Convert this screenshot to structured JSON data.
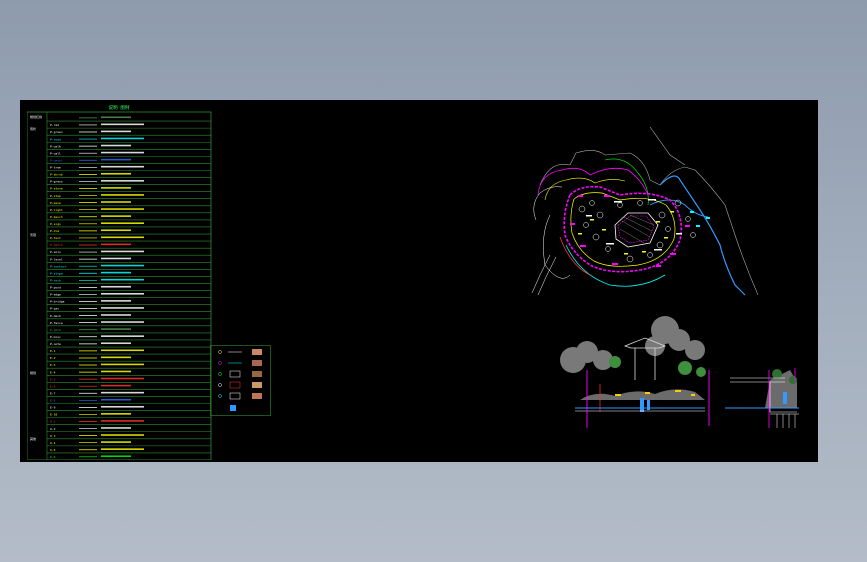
{
  "drawing": {
    "title": "说明 图例",
    "background": "#000000",
    "frame_color": "#2f8f2f"
  },
  "legend": {
    "group_labels": [
      "规划红线",
      "现状",
      "景观",
      "规划",
      "其他"
    ],
    "rows": [
      {
        "code": "--",
        "desc": "--",
        "color": "#5a8f5a"
      },
      {
        "code": "P-red",
        "desc": "--",
        "color": "#ffffff"
      },
      {
        "code": "P-green",
        "desc": "--",
        "color": "#ffffff"
      },
      {
        "code": "P-road",
        "desc": "--",
        "color": "#00ffff"
      },
      {
        "code": "P-walk",
        "desc": "--",
        "color": "#ffffff"
      },
      {
        "code": "P-wall",
        "desc": "--",
        "color": "#ffffff"
      },
      {
        "code": "P-water",
        "desc": "--",
        "color": "#3366ff"
      },
      {
        "code": "P-tree",
        "desc": "--",
        "color": "#ffffff"
      },
      {
        "code": "P-shrub",
        "desc": "--",
        "color": "#ffff00"
      },
      {
        "code": "P-grass",
        "desc": "--",
        "color": "#ffffff"
      },
      {
        "code": "P-stone",
        "desc": "--",
        "color": "#ffff00"
      },
      {
        "code": "P-step",
        "desc": "--",
        "color": "#ffff00"
      },
      {
        "code": "P-pave",
        "desc": "--",
        "color": "#ffff00"
      },
      {
        "code": "P-light",
        "desc": "--",
        "color": "#ffff00"
      },
      {
        "code": "P-bench",
        "desc": "--",
        "color": "#ffff00"
      },
      {
        "code": "P-sign",
        "desc": "--",
        "color": "#ffff00"
      },
      {
        "code": "P-dim",
        "desc": "--",
        "color": "#ffff00"
      },
      {
        "code": "P-text",
        "desc": "--",
        "color": "#ffff00"
      },
      {
        "code": "P-hatch",
        "desc": "--",
        "color": "#ff3333"
      },
      {
        "code": "P-axis",
        "desc": "--",
        "color": "#ffffff"
      },
      {
        "code": "P-level",
        "desc": "--",
        "color": "#ffffff"
      },
      {
        "code": "P-contour",
        "desc": "--",
        "color": "#00ffff"
      },
      {
        "code": "P-slope",
        "desc": "--",
        "color": "#00ffff"
      },
      {
        "code": "P-rock",
        "desc": "--",
        "color": "#00ffff"
      },
      {
        "code": "P-pond",
        "desc": "--",
        "color": "#ffffff"
      },
      {
        "code": "P-edge",
        "desc": "--",
        "color": "#ffffff"
      },
      {
        "code": "P-bridge",
        "desc": "--",
        "color": "#ffffff"
      },
      {
        "code": "P-pav",
        "desc": "--",
        "color": "#ffffff"
      },
      {
        "code": "P-deck",
        "desc": "--",
        "color": "#ffffff"
      },
      {
        "code": "P-fence",
        "desc": "--",
        "color": "#ffffff"
      },
      {
        "code": "P-gate",
        "desc": "--",
        "color": "#5a8f5a"
      },
      {
        "code": "P-misc",
        "desc": "--",
        "color": "#ffffff"
      },
      {
        "code": "P-note",
        "desc": "--",
        "color": "#ffffff"
      },
      {
        "code": "E-1",
        "desc": "--",
        "color": "#ffff00"
      },
      {
        "code": "E-2",
        "desc": "--",
        "color": "#ffff00"
      },
      {
        "code": "E-3",
        "desc": "--",
        "color": "#ffff00"
      },
      {
        "code": "E-4",
        "desc": "--",
        "color": "#ffff00"
      },
      {
        "code": "E-5",
        "desc": "--",
        "color": "#ff3333"
      },
      {
        "code": "E-6",
        "desc": "--",
        "color": "#ff3333"
      },
      {
        "code": "E-7",
        "desc": "--",
        "color": "#ffffff"
      },
      {
        "code": "E-8",
        "desc": "--",
        "color": "#3366ff"
      },
      {
        "code": "E-9",
        "desc": "--",
        "color": "#ffffff"
      },
      {
        "code": "E-10",
        "desc": "--",
        "color": "#ffff00"
      },
      {
        "code": "O-1",
        "desc": "--",
        "color": "#ff3333"
      },
      {
        "code": "O-2",
        "desc": "--",
        "color": "#ffffff"
      },
      {
        "code": "O-3",
        "desc": "--",
        "color": "#ffff00"
      },
      {
        "code": "O-4",
        "desc": "--",
        "color": "#ffff00"
      },
      {
        "code": "O-5",
        "desc": "--",
        "color": "#ffff00"
      },
      {
        "code": "O-6",
        "desc": "--",
        "color": "#00ff00"
      }
    ]
  },
  "colors": {
    "magenta": "#ff00ff",
    "cyan": "#00ffff",
    "yellow": "#ffff00",
    "white": "#ffffff",
    "green": "#00ff00",
    "blue": "#3399ff",
    "red": "#ff3333",
    "tree_gray": "#9a9a9a"
  }
}
